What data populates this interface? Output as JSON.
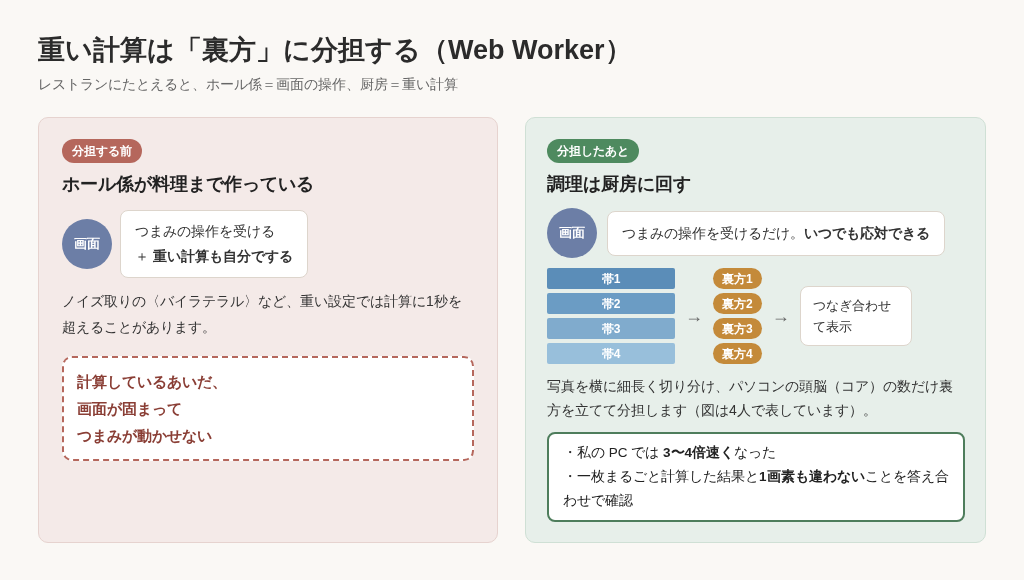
{
  "title": "重い計算は「裏方」に分担する（Web Worker）",
  "subtitle": "レストランにたとえると、ホール係＝画面の操作、厨房＝重い計算",
  "before": {
    "badge": "分担する前",
    "heading": "ホール係が料理まで作っている",
    "circle": "画面",
    "bubble": [
      "つまみの操作を受ける",
      "＋ **重い計算も自分でする**"
    ],
    "text": "ノイズ取りの〈バイラテラル〉など、重い設定では計算に1秒を超えることがあります。",
    "warning": [
      "計算しているあいだ、",
      "画面が固まって",
      "つまみが動かせない"
    ]
  },
  "after": {
    "badge": "分担したあと",
    "heading": "調理は厨房に回す",
    "circle": "画面",
    "bubble": "つまみの操作を受けるだけ。**いつでも応対できる**",
    "bands": [
      {
        "label": "帯1",
        "color": "#5b8db8"
      },
      {
        "label": "帯2",
        "color": "#6b9cc4"
      },
      {
        "label": "帯3",
        "color": "#80abcd"
      },
      {
        "label": "帯4",
        "color": "#98bfdb"
      }
    ],
    "arrow_1": "→",
    "workers": [
      "裏方1",
      "裏方2",
      "裏方3",
      "裏方4"
    ],
    "arrow_2": "→",
    "result": "つなぎ合わせて表示",
    "text": "写真を横に細長く切り分け、パソコンの頭脳（コア）の数だけ裏方を立てて分担します（図は4人で表しています）。",
    "notes": [
      "・私の PC では **3〜4倍速く**なった",
      "・一枚まるごと計算した結果と**1画素も違わない**ことを答え合わせで確認"
    ]
  }
}
